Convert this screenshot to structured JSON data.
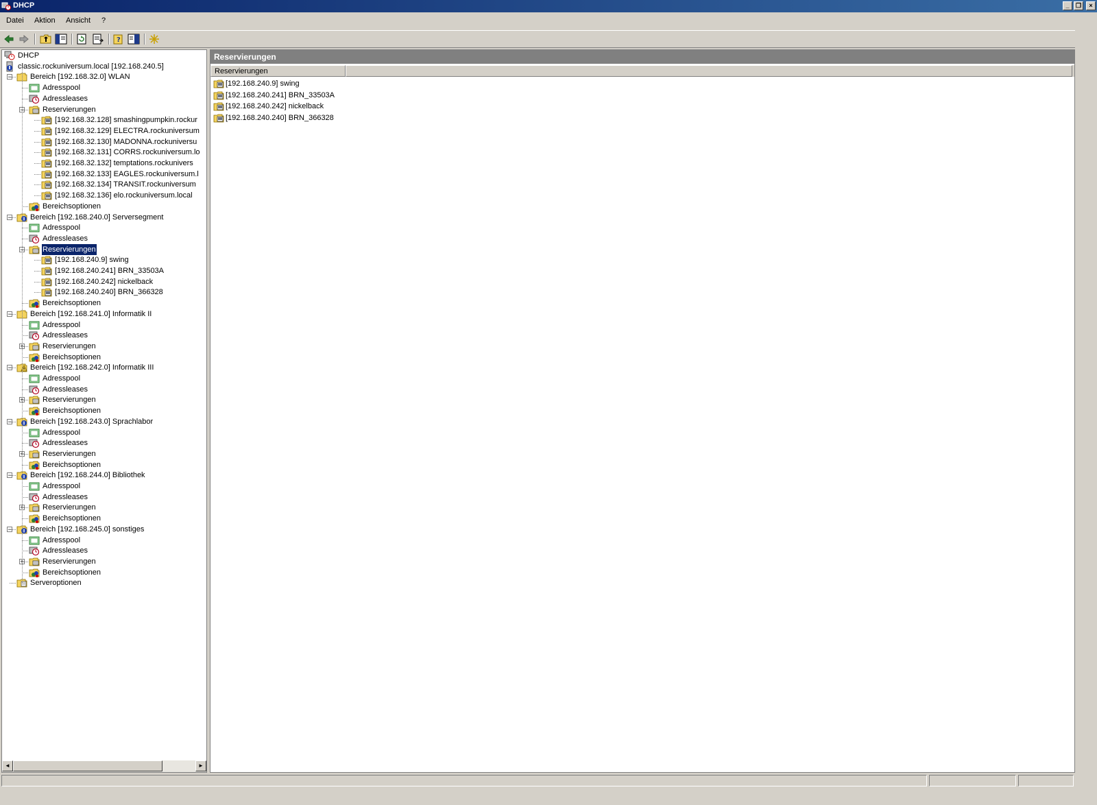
{
  "window": {
    "title": "DHCP",
    "minimize_label": "_",
    "restore_label": "❐",
    "close_label": "×"
  },
  "menu": {
    "items": [
      {
        "label": "Datei"
      },
      {
        "label": "Aktion"
      },
      {
        "label": "Ansicht"
      },
      {
        "label": "?"
      }
    ]
  },
  "toolbar": {
    "buttons": [
      "back-icon",
      "forward-icon",
      "up-folder-icon",
      "show-hide-tree-icon",
      "refresh-icon",
      "export-list-icon",
      "help-icon",
      "show-hide-action-pane-icon",
      "new-reservation-icon"
    ]
  },
  "tree": {
    "root": "DHCP",
    "server": "classic.rockuniversum.local [192.168.240.5]",
    "scopes": [
      {
        "label": "Bereich [192.168.32.0] WLAN",
        "children": [
          "Adresspool",
          "Adressleases",
          "Reservierungen",
          "Bereichsoptionen"
        ],
        "reservations": [
          "[192.168.32.128] smashingpumpkin.rockur",
          "[192.168.32.129] ELECTRA.rockuniversum",
          "[192.168.32.130] MADONNA.rockuniversu",
          "[192.168.32.131] CORRS.rockuniversum.lo",
          "[192.168.32.132] temptations.rockunivers",
          "[192.168.32.133] EAGLES.rockuniversum.l",
          "[192.168.32.134] TRANSIT.rockuniversum",
          "[192.168.32.136] elo.rockuniversum.local"
        ]
      },
      {
        "label": "Bereich [192.168.240.0] Serversegment",
        "children": [
          "Adresspool",
          "Adressleases",
          "Reservierungen",
          "Bereichsoptionen"
        ],
        "reservations": [
          "[192.168.240.9] swing",
          "[192.168.240.241] BRN_33503A",
          "[192.168.240.242] nickelback",
          "[192.168.240.240] BRN_366328"
        ]
      },
      {
        "label": "Bereich [192.168.241.0] Informatik II",
        "children": [
          "Adresspool",
          "Adressleases",
          "Reservierungen",
          "Bereichsoptionen"
        ]
      },
      {
        "label": "Bereich [192.168.242.0] Informatik III",
        "children": [
          "Adresspool",
          "Adressleases",
          "Reservierungen",
          "Bereichsoptionen"
        ]
      },
      {
        "label": "Bereich [192.168.243.0] Sprachlabor",
        "children": [
          "Adresspool",
          "Adressleases",
          "Reservierungen",
          "Bereichsoptionen"
        ]
      },
      {
        "label": "Bereich [192.168.244.0] Bibliothek",
        "children": [
          "Adresspool",
          "Adressleases",
          "Reservierungen",
          "Bereichsoptionen"
        ]
      },
      {
        "label": "Bereich [192.168.245.0] sonstiges",
        "children": [
          "Adresspool",
          "Adressleases",
          "Reservierungen",
          "Bereichsoptionen"
        ]
      }
    ],
    "server_options": "Serveroptionen",
    "selected": "Reservierungen"
  },
  "details": {
    "header": "Reservierungen",
    "column": "Reservierungen",
    "items": [
      "[192.168.240.9] swing",
      "[192.168.240.241] BRN_33503A",
      "[192.168.240.242] nickelback",
      "[192.168.240.240] BRN_366328"
    ]
  },
  "colors": {
    "titlebar_start": "#0a246a",
    "titlebar_end": "#3a6ea5",
    "selection": "#0a246a",
    "chrome": "#d4d0c8",
    "pane_header": "#808080"
  }
}
